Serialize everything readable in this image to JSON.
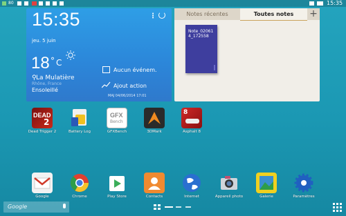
{
  "status_bar": {
    "time": "15:35",
    "battery_text": "80"
  },
  "weather_widget": {
    "time": "15:35",
    "date": "jeu. 5 juin",
    "temperature": "18",
    "unit": "C",
    "city": "La Mulatière",
    "region": "Rhône, France",
    "condition": "Ensoleillé",
    "events_label": "Aucun événem.",
    "action_label": "Ajout action",
    "updated": "MAJ 04/06/2014 17:01"
  },
  "notes_widget": {
    "tab_recent": "Notes récentes",
    "tab_all": "Toutes notes",
    "add": "+",
    "note_title": "Note_020614_172558"
  },
  "apps_row1": [
    {
      "label": "Dead Trigger 2",
      "icon": "dead-trigger-icon",
      "color": "#b01c1c"
    },
    {
      "label": "Battery Log",
      "icon": "battery-log-icon",
      "color": "#f0c020"
    },
    {
      "label": "GFXBench",
      "icon": "gfxbench-icon",
      "color": "#ffffff"
    },
    {
      "label": "3DMark",
      "icon": "3dmark-icon",
      "color": "#2a2a2a"
    },
    {
      "label": "Asphalt 8",
      "icon": "asphalt-icon",
      "color": "#c02020"
    }
  ],
  "dock": [
    {
      "label": "Google",
      "icon": "gmail-icon",
      "color": "#e04030"
    },
    {
      "label": "Chrome",
      "icon": "chrome-icon",
      "color": "#2d9d4a"
    },
    {
      "label": "Play Store",
      "icon": "play-store-icon",
      "color": "#ffffff"
    },
    {
      "label": "Contacts",
      "icon": "contacts-icon",
      "color": "#f08a30"
    },
    {
      "label": "Internet",
      "icon": "internet-icon",
      "color": "#2a6fd0"
    },
    {
      "label": "Appareil photo",
      "icon": "camera-icon",
      "color": "#d0d4da"
    },
    {
      "label": "Galerie",
      "icon": "gallery-icon",
      "color": "#f0d020"
    },
    {
      "label": "Paramètres",
      "icon": "settings-icon",
      "color": "#2060c0"
    }
  ],
  "google_search": {
    "label": "Google"
  }
}
